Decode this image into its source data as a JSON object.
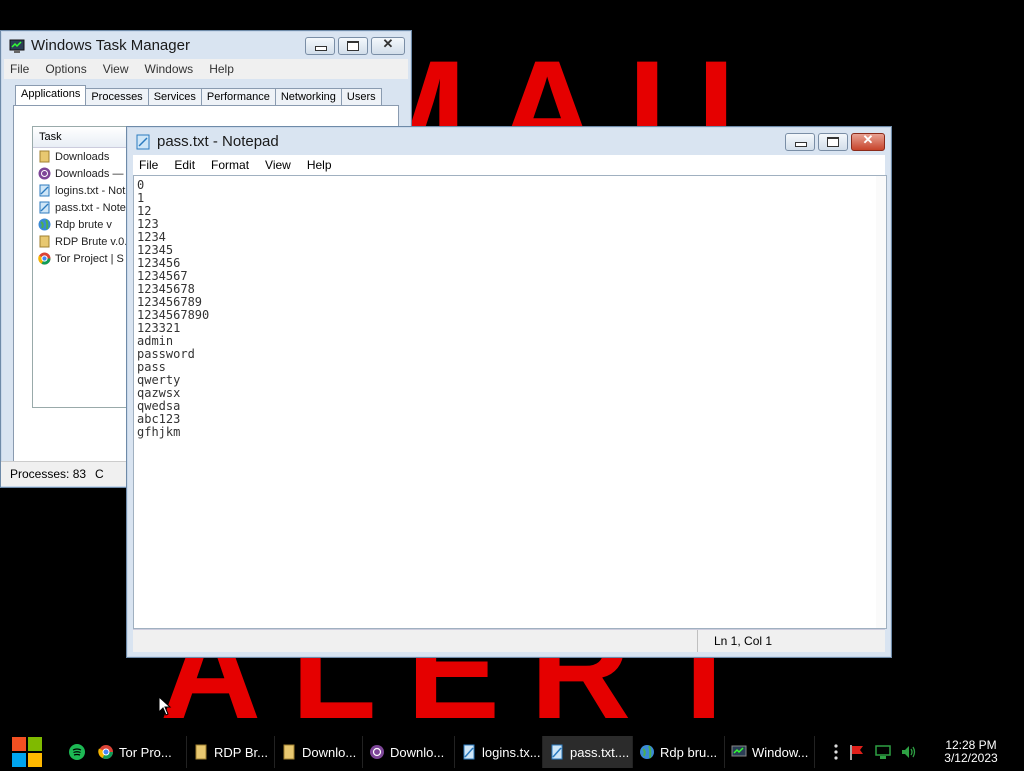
{
  "wallpaper": {
    "top_text": "MAIL",
    "bottom_text": "ALERT"
  },
  "task_manager": {
    "title": "Windows Task Manager",
    "menu": [
      "File",
      "Options",
      "View",
      "Windows",
      "Help"
    ],
    "tabs": [
      "Applications",
      "Processes",
      "Services",
      "Performance",
      "Networking",
      "Users"
    ],
    "column_task": "Task",
    "rows": [
      "Downloads",
      "Downloads — T",
      "logins.txt - Not",
      "pass.txt - Note",
      "Rdp brute v",
      "RDP Brute v.0.",
      "Tor Project | S"
    ],
    "status_processes": "Processes: 83",
    "status_cpu": "C"
  },
  "notepad": {
    "title": "pass.txt - Notepad",
    "menu": [
      "File",
      "Edit",
      "Format",
      "View",
      "Help"
    ],
    "lines": [
      "0",
      "1",
      "12",
      "123",
      "1234",
      "12345",
      "123456",
      "1234567",
      "12345678",
      "123456789",
      "1234567890",
      "123321",
      "admin",
      "password",
      "pass",
      "qwerty",
      "qazwsx",
      "qwedsa",
      "abc123",
      "gfhjkm"
    ],
    "status_position": "Ln 1, Col 1"
  },
  "taskbar": {
    "buttons": [
      "Tor Pro...",
      "RDP Br...",
      "Downlo...",
      "Downlo...",
      "logins.tx...",
      "pass.txt....",
      "Rdp bru...",
      "Window..."
    ],
    "clock_time": "12:28 PM",
    "clock_date": "3/12/2023"
  }
}
